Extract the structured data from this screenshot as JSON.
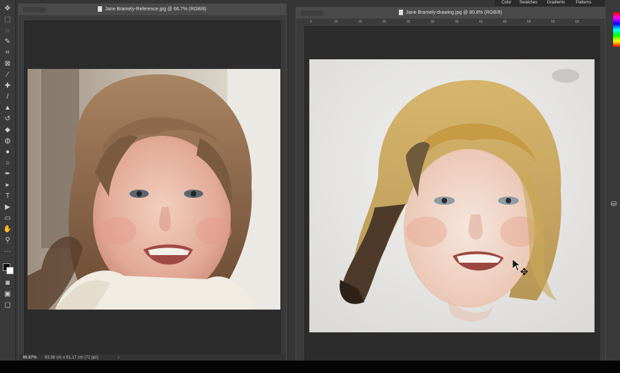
{
  "panel_tabs": {
    "color": "Color",
    "swatches": "Swatches",
    "gradients": "Gradients",
    "patterns": "Patterns"
  },
  "reference_doc": {
    "title": "Jane Bramely-Reference.jpg @ 66.7% (RGB/8)",
    "zoom": "66.67%",
    "size_info": "63.98 cm x 61.17 cm (72 ppi)",
    "status_arrow": "›"
  },
  "drawing_doc": {
    "title": "Jane Bramely-drawing.jpg @ 80.8% (RGB/8)",
    "ruler_ticks": [
      "5",
      "10",
      "15",
      "20",
      "25",
      "30",
      "35",
      "40",
      "45",
      "50",
      "55",
      "60"
    ]
  },
  "tools": [
    "move-tool",
    "marquee-tool",
    "lasso-tool",
    "quick-select-tool",
    "crop-tool",
    "frame-tool",
    "eyedropper-tool",
    "healing-tool",
    "brush-tool",
    "stamp-tool",
    "history-brush-tool",
    "eraser-tool",
    "paint-bucket-tool",
    "blur-tool",
    "dodge-tool",
    "pen-tool",
    "type-tool",
    "path-select-tool",
    "rectangle-tool",
    "hand-tool",
    "zoom-tool",
    "more-tools"
  ]
}
